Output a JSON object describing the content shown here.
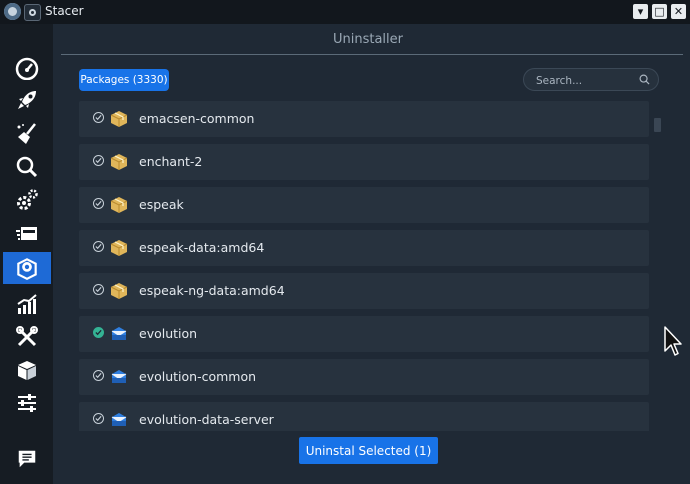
{
  "window": {
    "title": "Stacer",
    "controls": {
      "minimize": "▾",
      "maximize": "□",
      "close": "✕"
    }
  },
  "sidebar": {
    "items": [
      {
        "icon": "dashboard-icon",
        "active": false
      },
      {
        "icon": "rocket-icon",
        "active": false
      },
      {
        "icon": "broom-icon",
        "active": false
      },
      {
        "icon": "search-icon",
        "active": false
      },
      {
        "icon": "gears-icon",
        "active": false
      },
      {
        "icon": "processes-icon",
        "active": false
      },
      {
        "icon": "uninstaller-icon",
        "active": true
      },
      {
        "icon": "resources-chart-icon",
        "active": false
      },
      {
        "icon": "tools-icon",
        "active": false
      },
      {
        "icon": "apt-repository-icon",
        "active": false
      },
      {
        "icon": "settings-sliders-icon",
        "active": false
      },
      {
        "icon": "feedback-icon",
        "active": false
      }
    ]
  },
  "header": {
    "title": "Uninstaller"
  },
  "packages_badge": "Packages (3330)",
  "search": {
    "placeholder": "Search...",
    "value": ""
  },
  "packages": [
    {
      "name": "emacsen-common",
      "type": "package",
      "selected": false
    },
    {
      "name": "enchant-2",
      "type": "package",
      "selected": false
    },
    {
      "name": "espeak",
      "type": "package",
      "selected": false
    },
    {
      "name": "espeak-data:amd64",
      "type": "package",
      "selected": false
    },
    {
      "name": "espeak-ng-data:amd64",
      "type": "package",
      "selected": false
    },
    {
      "name": "evolution",
      "type": "mail",
      "selected": true
    },
    {
      "name": "evolution-common",
      "type": "mail",
      "selected": false
    },
    {
      "name": "evolution-data-server",
      "type": "mail",
      "selected": false
    }
  ],
  "uninstall_button": "Uninstal Selected (1)",
  "colors": {
    "accent": "#1873e8",
    "sidebar_active": "#1e6ad6",
    "check_selected": "#34b394",
    "row_bg": "#27323e",
    "window_bg": "#1f2935"
  }
}
